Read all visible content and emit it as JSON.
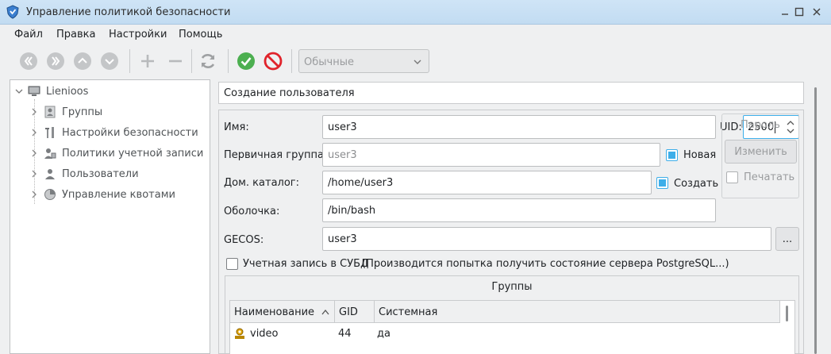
{
  "window": {
    "title": "Управление политикой безопасности"
  },
  "menu": [
    "Файл",
    "Правка",
    "Настройки",
    "Помощь"
  ],
  "toolbar": {
    "filter_value": "Обычные"
  },
  "tree": {
    "root": "Lienioos",
    "items": [
      "Группы",
      "Настройки безопасности",
      "Политики учетной записи",
      "Пользователи",
      "Управление квотами"
    ]
  },
  "panel": {
    "header": "Создание пользователя",
    "name_label": "Имя:",
    "name_value": "user3",
    "uid_label": "UID:",
    "uid_value": "2500",
    "group_label": "Первичная группа:",
    "group_value": "user3",
    "new_label": "Новая",
    "home_label": "Дом. каталог:",
    "home_value": "/home/user3",
    "create_label": "Создать",
    "shell_label": "Оболочка:",
    "shell_value": "/bin/bash",
    "gecos_label": "GECOS:",
    "gecos_value": "user3",
    "gecos_button": "...",
    "password_label": "Пароль",
    "change_button": "Изменить",
    "print_label": "Печатать",
    "dbms_label": "Учетная запись в СУБД",
    "dbms_status": "(Производится попытка получить состояние сервера PostgreSQL...)"
  },
  "groups": {
    "title": "Группы",
    "columns": [
      "Наименование",
      "GID",
      "Системная"
    ],
    "rows": [
      {
        "name": "video",
        "gid": "44",
        "system": "да"
      }
    ]
  }
}
